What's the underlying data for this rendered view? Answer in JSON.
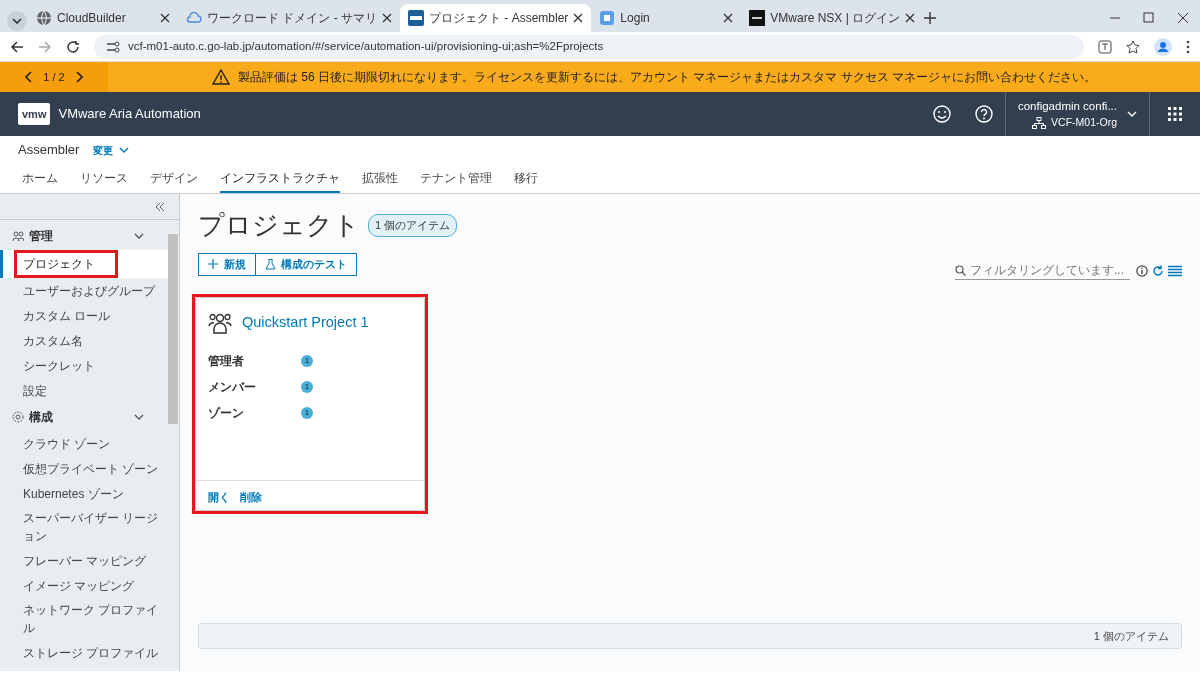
{
  "browser": {
    "tabs": [
      {
        "title": "CloudBuilder",
        "selected": false
      },
      {
        "title": "ワークロード ドメイン - サマリ",
        "selected": false
      },
      {
        "title": "プロジェクト - Assembler",
        "selected": true
      },
      {
        "title": "Login",
        "selected": false
      },
      {
        "title": "VMware NSX | ログイン",
        "selected": false
      }
    ],
    "url": "vcf-m01-auto.c.go-lab.jp/automation/#/service/automation-ui/provisioning-ui;ash=%2Fprojects"
  },
  "banner": {
    "pager": "1 / 2",
    "message": "製品評価は 56 日後に期限切れになります。ライセンスを更新するには、アカウント マネージャまたはカスタマ サクセス マネージャにお問い合わせください。"
  },
  "header": {
    "logo": "vmw",
    "product": "VMware Aria Automation",
    "user": "configadmin confi...",
    "org": "VCF-M01-Org"
  },
  "app": {
    "name": "Assembler",
    "switch_label": "変更"
  },
  "nav": [
    {
      "label": "ホーム",
      "selected": false
    },
    {
      "label": "リソース",
      "selected": false
    },
    {
      "label": "デザイン",
      "selected": false
    },
    {
      "label": "インフラストラクチャ",
      "selected": true
    },
    {
      "label": "拡張性",
      "selected": false
    },
    {
      "label": "テナント管理",
      "selected": false
    },
    {
      "label": "移行",
      "selected": false
    }
  ],
  "sidebar": {
    "sections": [
      {
        "title": "管理",
        "expanded": true,
        "items": [
          {
            "label": "プロジェクト",
            "selected": true,
            "highlighted": true
          },
          {
            "label": "ユーザーおよびグループ",
            "selected": false,
            "highlighted": false
          },
          {
            "label": "カスタム ロール",
            "selected": false,
            "highlighted": false
          },
          {
            "label": "カスタム名",
            "selected": false,
            "highlighted": false
          },
          {
            "label": "シークレット",
            "selected": false,
            "highlighted": false
          },
          {
            "label": "設定",
            "selected": false,
            "highlighted": false
          }
        ]
      },
      {
        "title": "構成",
        "expanded": true,
        "items": [
          {
            "label": "クラウド ゾーン",
            "selected": false,
            "highlighted": false
          },
          {
            "label": "仮想プライベート ゾーン",
            "selected": false,
            "highlighted": false
          },
          {
            "label": "Kubernetes ゾーン",
            "selected": false,
            "highlighted": false
          },
          {
            "label": "スーパーバイザー リージョン",
            "selected": false,
            "highlighted": false
          },
          {
            "label": "フレーバー マッピング",
            "selected": false,
            "highlighted": false
          },
          {
            "label": "イメージ マッピング",
            "selected": false,
            "highlighted": false
          },
          {
            "label": "ネットワーク プロファイル",
            "selected": false,
            "highlighted": false
          },
          {
            "label": "ストレージ プロファイル",
            "selected": false,
            "highlighted": false
          }
        ]
      }
    ]
  },
  "page": {
    "title": "プロジェクト",
    "count_badge": "1 個のアイテム",
    "buttons": [
      {
        "label": "新規"
      },
      {
        "label": "構成のテスト"
      }
    ],
    "filter_placeholder": "フィルタリングしています..."
  },
  "projects": [
    {
      "name": "Quickstart Project 1",
      "highlighted": true,
      "fields": [
        {
          "label": "管理者",
          "value": "1"
        },
        {
          "label": "メンバー",
          "value": "1"
        },
        {
          "label": "ゾーン",
          "value": "1"
        }
      ],
      "actions": [
        "開く",
        "削除"
      ]
    }
  ],
  "footer": {
    "count": "1 個のアイテム"
  }
}
